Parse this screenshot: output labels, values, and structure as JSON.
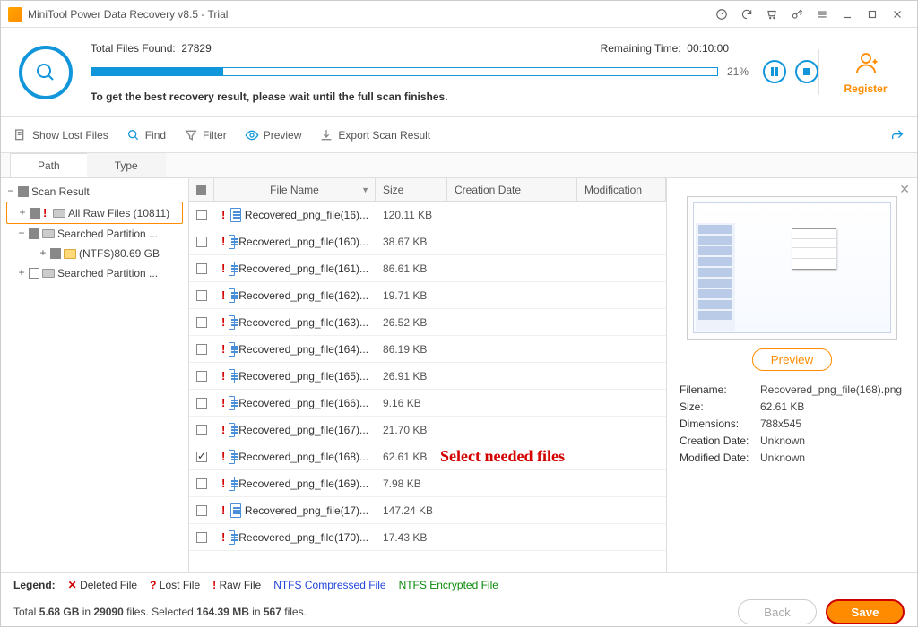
{
  "window": {
    "title": "MiniTool Power Data Recovery v8.5 - Trial"
  },
  "scan": {
    "total_label": "Total Files Found:",
    "total_value": "27829",
    "remaining_label": "Remaining Time:",
    "remaining_value": "00:10:00",
    "percent": "21%",
    "progress_pct": 21,
    "hint": "To get the best recovery result, please wait until the full scan finishes."
  },
  "register": {
    "label": "Register"
  },
  "toolbar": {
    "show_lost": "Show Lost Files",
    "find": "Find",
    "filter": "Filter",
    "preview": "Preview",
    "export": "Export Scan Result"
  },
  "tabs": {
    "path": "Path",
    "type": "Type"
  },
  "tree": {
    "root": "Scan Result",
    "all_raw": "All Raw Files (10811)",
    "searched1": "Searched Partition ...",
    "ntfs": "(NTFS)80.69 GB",
    "searched2": "Searched Partition ..."
  },
  "columns": {
    "name": "File Name",
    "size": "Size",
    "created": "Creation Date",
    "mod": "Modification"
  },
  "files": [
    {
      "name": "Recovered_png_file(16)...",
      "size": "120.11 KB",
      "checked": false
    },
    {
      "name": "Recovered_png_file(160)...",
      "size": "38.67 KB",
      "checked": false
    },
    {
      "name": "Recovered_png_file(161)...",
      "size": "86.61 KB",
      "checked": false
    },
    {
      "name": "Recovered_png_file(162)...",
      "size": "19.71 KB",
      "checked": false
    },
    {
      "name": "Recovered_png_file(163)...",
      "size": "26.52 KB",
      "checked": false
    },
    {
      "name": "Recovered_png_file(164)...",
      "size": "86.19 KB",
      "checked": false
    },
    {
      "name": "Recovered_png_file(165)...",
      "size": "26.91 KB",
      "checked": false
    },
    {
      "name": "Recovered_png_file(166)...",
      "size": "9.16 KB",
      "checked": false
    },
    {
      "name": "Recovered_png_file(167)...",
      "size": "21.70 KB",
      "checked": false
    },
    {
      "name": "Recovered_png_file(168)...",
      "size": "62.61 KB",
      "checked": true
    },
    {
      "name": "Recovered_png_file(169)...",
      "size": "7.98 KB",
      "checked": false
    },
    {
      "name": "Recovered_png_file(17)...",
      "size": "147.24 KB",
      "checked": false
    },
    {
      "name": "Recovered_png_file(170)...",
      "size": "17.43 KB",
      "checked": false
    }
  ],
  "annotation": "Select needed files",
  "preview": {
    "btn": "Preview",
    "filename_k": "Filename:",
    "filename_v": "Recovered_png_file(168).png",
    "size_k": "Size:",
    "size_v": "62.61 KB",
    "dim_k": "Dimensions:",
    "dim_v": "788x545",
    "created_k": "Creation Date:",
    "created_v": "Unknown",
    "modified_k": "Modified Date:",
    "modified_v": "Unknown"
  },
  "legend": {
    "label": "Legend:",
    "deleted": "Deleted File",
    "lost": "Lost File",
    "raw": "Raw File",
    "compressed": "NTFS Compressed File",
    "encrypted": "NTFS Encrypted File"
  },
  "footer": {
    "status_prefix": "Total ",
    "total_size": "5.68 GB",
    "in": " in ",
    "total_files": "29090",
    "files_sel": " files.  Selected ",
    "sel_size": "164.39 MB",
    "sel_in": " in ",
    "sel_files": "567",
    "suffix": " files.",
    "back": "Back",
    "save": "Save"
  }
}
